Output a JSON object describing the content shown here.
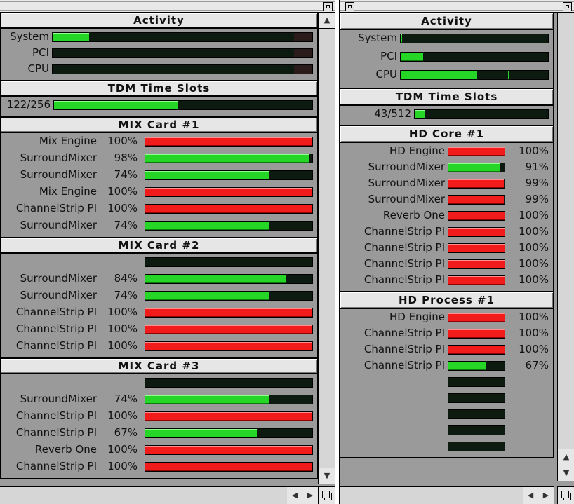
{
  "left_window": {
    "activity": {
      "title": "Activity",
      "rows": [
        {
          "label": "System",
          "level": 0.14
        },
        {
          "label": "PCI",
          "level": 0.0
        },
        {
          "label": "CPU",
          "level": 0.0
        }
      ]
    },
    "tdm": {
      "title": "TDM Time Slots",
      "value": "122/256",
      "level": 0.48
    },
    "cards": [
      {
        "title": "MIX Card #1",
        "rows": [
          {
            "label": "Mix Engine",
            "pct": "100%",
            "level": 1.0,
            "color": "red"
          },
          {
            "label": "SurroundMixer",
            "pct": "98%",
            "level": 0.98,
            "color": "green"
          },
          {
            "label": "SurroundMixer",
            "pct": "74%",
            "level": 0.74,
            "color": "green"
          },
          {
            "label": "Mix Engine",
            "pct": "100%",
            "level": 1.0,
            "color": "red"
          },
          {
            "label": "ChannelStrip PI",
            "pct": "100%",
            "level": 1.0,
            "color": "red"
          },
          {
            "label": "SurroundMixer",
            "pct": "74%",
            "level": 0.74,
            "color": "green"
          }
        ]
      },
      {
        "title": "MIX Card #2",
        "rows": [
          {
            "label": "",
            "pct": "",
            "level": 0.0,
            "color": "green"
          },
          {
            "label": "SurroundMixer",
            "pct": "84%",
            "level": 0.84,
            "color": "green"
          },
          {
            "label": "SurroundMixer",
            "pct": "74%",
            "level": 0.74,
            "color": "green"
          },
          {
            "label": "ChannelStrip PI",
            "pct": "100%",
            "level": 1.0,
            "color": "red"
          },
          {
            "label": "ChannelStrip PI",
            "pct": "100%",
            "level": 1.0,
            "color": "red"
          },
          {
            "label": "ChannelStrip PI",
            "pct": "100%",
            "level": 1.0,
            "color": "red"
          }
        ]
      },
      {
        "title": "MIX Card #3",
        "rows": [
          {
            "label": "",
            "pct": "",
            "level": 0.0,
            "color": "green"
          },
          {
            "label": "SurroundMixer",
            "pct": "74%",
            "level": 0.74,
            "color": "green"
          },
          {
            "label": "ChannelStrip PI",
            "pct": "100%",
            "level": 1.0,
            "color": "red"
          },
          {
            "label": "ChannelStrip PI",
            "pct": "67%",
            "level": 0.67,
            "color": "green"
          },
          {
            "label": "Reverb One",
            "pct": "100%",
            "level": 1.0,
            "color": "red"
          },
          {
            "label": "ChannelStrip PI",
            "pct": "100%",
            "level": 1.0,
            "color": "red"
          }
        ]
      }
    ]
  },
  "right_window": {
    "activity": {
      "title": "Activity",
      "rows": [
        {
          "label": "System",
          "level": 0.01
        },
        {
          "label": "PCI",
          "level": 0.15
        },
        {
          "label": "CPU",
          "level": 0.52,
          "peak": 0.73
        }
      ]
    },
    "tdm": {
      "title": "TDM Time Slots",
      "value": "43/512",
      "level": 0.08
    },
    "cards": [
      {
        "title": "HD Core #1",
        "rows": [
          {
            "label": "HD Engine",
            "pct": "100%",
            "level": 1.0,
            "color": "red"
          },
          {
            "label": "SurroundMixer",
            "pct": "91%",
            "level": 0.91,
            "color": "green"
          },
          {
            "label": "SurroundMixer",
            "pct": "99%",
            "level": 0.99,
            "color": "red"
          },
          {
            "label": "SurroundMixer",
            "pct": "99%",
            "level": 0.99,
            "color": "red"
          },
          {
            "label": "Reverb One",
            "pct": "100%",
            "level": 1.0,
            "color": "red"
          },
          {
            "label": "ChannelStrip PI",
            "pct": "100%",
            "level": 1.0,
            "color": "red"
          },
          {
            "label": "ChannelStrip PI",
            "pct": "100%",
            "level": 1.0,
            "color": "red"
          },
          {
            "label": "ChannelStrip PI",
            "pct": "100%",
            "level": 1.0,
            "color": "red"
          },
          {
            "label": "ChannelStrip PI",
            "pct": "100%",
            "level": 1.0,
            "color": "red"
          }
        ]
      },
      {
        "title": "HD Process #1",
        "rows": [
          {
            "label": "HD Engine",
            "pct": "100%",
            "level": 1.0,
            "color": "red"
          },
          {
            "label": "ChannelStrip PI",
            "pct": "100%",
            "level": 1.0,
            "color": "red"
          },
          {
            "label": "ChannelStrip PI",
            "pct": "100%",
            "level": 1.0,
            "color": "red"
          },
          {
            "label": "ChannelStrip PI",
            "pct": "67%",
            "level": 0.67,
            "color": "green"
          },
          {
            "label": "",
            "pct": "",
            "level": 0.0,
            "color": "green"
          },
          {
            "label": "",
            "pct": "",
            "level": 0.0,
            "color": "green"
          },
          {
            "label": "",
            "pct": "",
            "level": 0.0,
            "color": "green"
          },
          {
            "label": "",
            "pct": "",
            "level": 0.0,
            "color": "green"
          },
          {
            "label": "",
            "pct": "",
            "level": 0.0,
            "color": "green"
          }
        ]
      }
    ]
  },
  "colors": {
    "green": "#26d626",
    "red": "#f21b1b",
    "meter_bg": "#0d1a10",
    "panel": "#9c9c9c"
  },
  "icons": [
    "close-box-icon",
    "zoom-box-icon",
    "scroll-up-arrow-icon",
    "scroll-down-arrow-icon",
    "scroll-left-arrow-icon",
    "scroll-right-arrow-icon",
    "grow-box-icon"
  ]
}
